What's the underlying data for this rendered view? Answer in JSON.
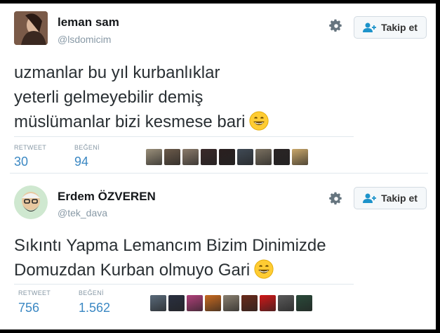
{
  "tweets": [
    {
      "name": "leman sam",
      "handle": "@lsdomicim",
      "follow_label": "Takip et",
      "text_lines": [
        "uzmanlar bu yıl kurbanlıklar",
        "yeterli gelmeyebilir demiş",
        "müslümanlar bizi kesmese bari"
      ],
      "emoji": "grinning-face",
      "retweet_label": "RETWEET",
      "retweet_count": "30",
      "like_label": "BEĞENİ",
      "like_count": "94",
      "liker_colors": [
        "#9a8f7a",
        "#6b5a4a",
        "#8a7a6a",
        "#3a2a2a",
        "#2a2020",
        "#404a55",
        "#7a7060",
        "#2a2424",
        "#c9a76a"
      ]
    },
    {
      "name": "Erdem ÖZVEREN",
      "handle": "@tek_dava",
      "follow_label": "Takip et",
      "text_lines": [
        "Sıkıntı Yapma Lemancım Bizim Dinimizde",
        "Domuzdan Kurban olmuyo Gari"
      ],
      "emoji": "grinning-face",
      "retweet_label": "RETWEET",
      "retweet_count": "756",
      "like_label": "BEĞENİ",
      "like_count": "1.562",
      "liker_colors": [
        "#5a6a7a",
        "#2a3040",
        "#b0407a",
        "#c86a20",
        "#8a8070",
        "#6a2a1a",
        "#d01818",
        "#5a5a5a",
        "#2a4a3a"
      ]
    }
  ],
  "colors": {
    "stat_value": "#3b88c3",
    "muted": "#8899a6",
    "button_bg": "#f5f8fa",
    "follow_icon": "#1d93ca"
  }
}
